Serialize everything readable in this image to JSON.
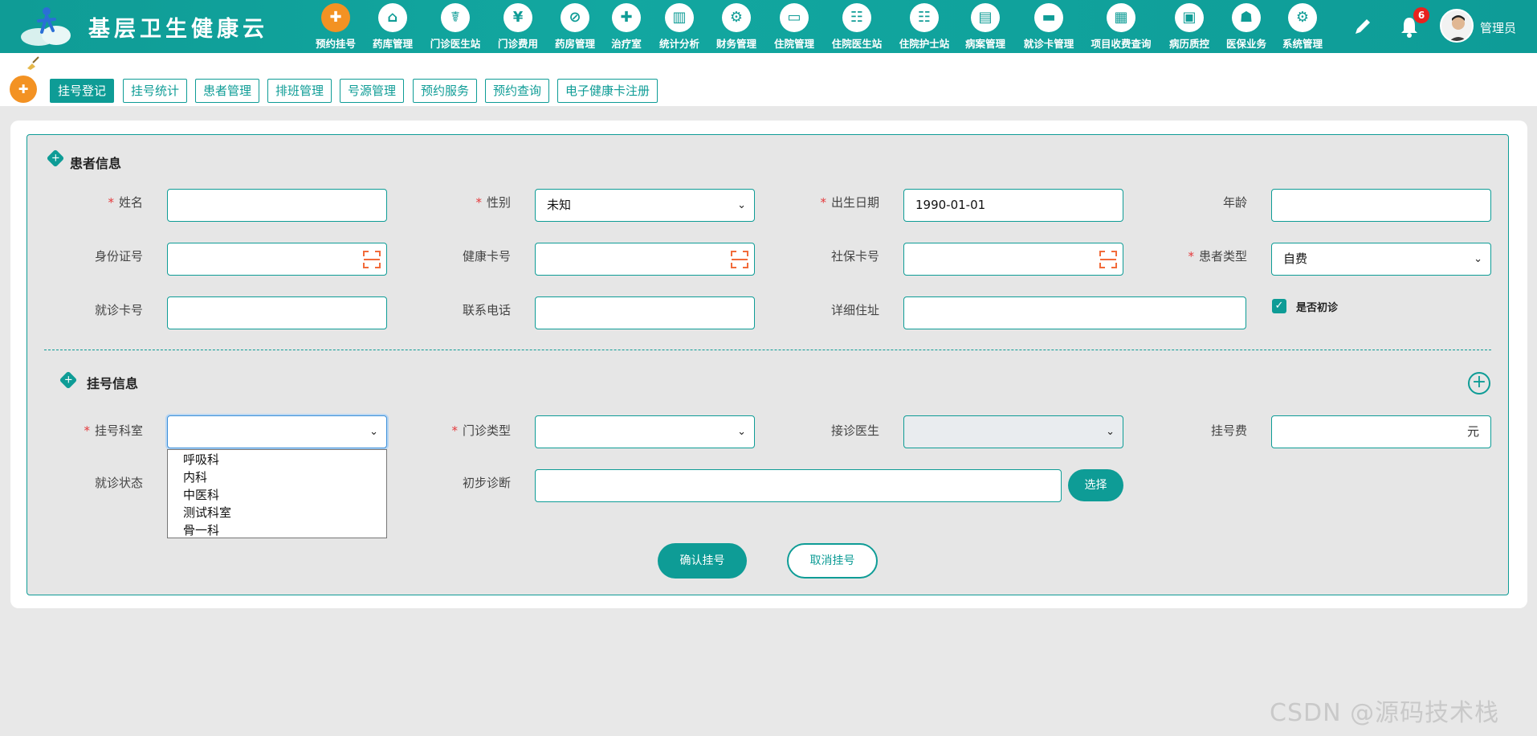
{
  "app": {
    "brand": "基层卫生健康云"
  },
  "top_nav": [
    {
      "label": "预约挂号",
      "icon": "calendar-icon",
      "active": true
    },
    {
      "label": "药库管理",
      "icon": "house-icon"
    },
    {
      "label": "门诊医生站",
      "icon": "doctor-icon"
    },
    {
      "label": "门诊费用",
      "icon": "yen-icon"
    },
    {
      "label": "药房管理",
      "icon": "pill-icon"
    },
    {
      "label": "治疗室",
      "icon": "nurse-icon"
    },
    {
      "label": "统计分析",
      "icon": "chart-icon"
    },
    {
      "label": "财务管理",
      "icon": "gear-money-icon"
    },
    {
      "label": "住院管理",
      "icon": "bed-icon"
    },
    {
      "label": "住院医生站",
      "icon": "doctor-card-icon"
    },
    {
      "label": "住院护士站",
      "icon": "nurse-card-icon"
    },
    {
      "label": "病案管理",
      "icon": "record-icon"
    },
    {
      "label": "就诊卡管理",
      "icon": "card-icon"
    },
    {
      "label": "项目收费查询",
      "icon": "invoice-icon"
    },
    {
      "label": "病历质控",
      "icon": "file-check-icon"
    },
    {
      "label": "医保业务",
      "icon": "insurance-icon"
    },
    {
      "label": "系统管理",
      "icon": "settings-icon"
    }
  ],
  "header": {
    "notification_count": "6",
    "user_name": "管理员"
  },
  "sub_tabs": [
    {
      "label": "挂号登记",
      "active": true
    },
    {
      "label": "挂号统计"
    },
    {
      "label": "患者管理"
    },
    {
      "label": "排班管理"
    },
    {
      "label": "号源管理"
    },
    {
      "label": "预约服务"
    },
    {
      "label": "预约查询"
    },
    {
      "label": "电子健康卡注册"
    }
  ],
  "patient_section": {
    "title": "患者信息",
    "fields": {
      "name": {
        "label": "姓名",
        "required": true,
        "value": ""
      },
      "gender": {
        "label": "性别",
        "required": true,
        "value": "未知"
      },
      "birth_date": {
        "label": "出生日期",
        "required": true,
        "value": "1990-01-01"
      },
      "age": {
        "label": "年龄",
        "value": ""
      },
      "id_number": {
        "label": "身份证号",
        "value": ""
      },
      "health_card": {
        "label": "健康卡号",
        "value": ""
      },
      "social_security": {
        "label": "社保卡号",
        "value": ""
      },
      "patient_type": {
        "label": "患者类型",
        "required": true,
        "value": "自费"
      },
      "visit_card": {
        "label": "就诊卡号",
        "value": ""
      },
      "phone": {
        "label": "联系电话",
        "value": ""
      },
      "address": {
        "label": "详细住址",
        "value": ""
      },
      "first_visit": {
        "label": "是否初诊",
        "checked": true
      }
    }
  },
  "registration_section": {
    "title": "挂号信息",
    "fields": {
      "department": {
        "label": "挂号科室",
        "required": true,
        "value": ""
      },
      "clinic_type": {
        "label": "门诊类型",
        "required": true,
        "value": ""
      },
      "doctor": {
        "label": "接诊医生",
        "value": ""
      },
      "fee": {
        "label": "挂号费",
        "value": "",
        "unit": "元"
      },
      "visit_status": {
        "label": "就诊状态"
      },
      "diagnosis": {
        "label": "初步诊断",
        "value": ""
      }
    },
    "select_button": "选择",
    "department_options": [
      "呼吸科",
      "内科",
      "中医科",
      "测试科室",
      "骨一科"
    ]
  },
  "actions": {
    "confirm": "确认挂号",
    "cancel": "取消挂号"
  },
  "watermark": "CSDN @源码技术栈",
  "colors": {
    "primary": "#0e9c96",
    "accent": "#f39223",
    "required": "#e5393c",
    "badge": "#e8221e"
  }
}
